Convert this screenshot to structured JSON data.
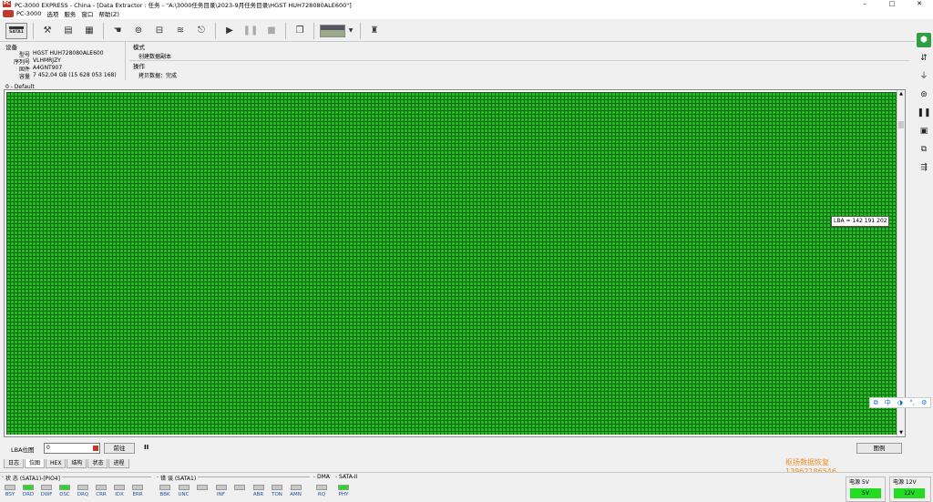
{
  "window": {
    "title": "PC-3000 EXPRESS - China - [Data Extractor : 任务 - \"A:\\3000任务目录\\2023-9月任务目录\\HGST HUH728080ALE600\"]",
    "app_icon_label": "PC",
    "minimize": "–",
    "maximize": "□",
    "close": "✕"
  },
  "menu": {
    "items": [
      "PC-3000",
      "选项",
      "服务",
      "窗口",
      "帮助(Z)"
    ]
  },
  "toolbar": {
    "sata_label": "SATA1"
  },
  "device": {
    "group_title": "设备",
    "rows": [
      {
        "label": "型号",
        "value": "HGST HUH728080ALE600"
      },
      {
        "label": "序列号",
        "value": "VLHMRJZY"
      },
      {
        "label": "固件",
        "value": "A4GNT907"
      },
      {
        "label": "容量",
        "value": "7 452,04 GB (15 628 053 168)"
      }
    ]
  },
  "mode": {
    "mode_title": "模式",
    "mode_value": "创建数据副本",
    "op_title": "操作",
    "op_value": "拷贝数据：完成"
  },
  "map": {
    "label": "0 - Default",
    "lba_tooltip": "LBA =  142 191 202",
    "scroll_up": "▲",
    "scroll_down": "▼",
    "fill_color": "#23b823"
  },
  "ime": {
    "items": [
      "中",
      "◑",
      "°,",
      "⚙"
    ],
    "lang": "中"
  },
  "nav": {
    "label": "LBA位图",
    "input_value": "0",
    "goto_button": "前往",
    "pause_symbol": "II",
    "legend_button": "图例"
  },
  "tabs": [
    "日志",
    "位图",
    "HEX",
    "结构",
    "状态",
    "进程"
  ],
  "watermark": {
    "line1": "枢扬数据恢复",
    "line2": "13962186546"
  },
  "status": {
    "state_title": "状 态 (SATA1)-[PIO4]",
    "state_leds": [
      {
        "name": "BSY",
        "on": false
      },
      {
        "name": "DRD",
        "on": true
      },
      {
        "name": "DWF",
        "on": false
      },
      {
        "name": "DSC",
        "on": true
      },
      {
        "name": "DRQ",
        "on": false
      },
      {
        "name": "CRR",
        "on": false
      },
      {
        "name": "IDX",
        "on": false
      },
      {
        "name": "ERR",
        "on": false
      }
    ],
    "error_title": "错 误 (SATA1)",
    "error_leds": [
      {
        "name": "BBK",
        "on": false
      },
      {
        "name": "UNC",
        "on": false
      },
      {
        "name": "",
        "on": false
      },
      {
        "name": "INF",
        "on": false
      },
      {
        "name": "",
        "on": false
      },
      {
        "name": "ABR",
        "on": false
      },
      {
        "name": "TON",
        "on": false
      },
      {
        "name": "AMN",
        "on": false
      }
    ],
    "dma_title": "DMA",
    "dma_leds": [
      {
        "name": "RQ",
        "on": false
      }
    ],
    "sata_title": "SATA-II",
    "sata_leds": [
      {
        "name": "PHY",
        "on": true
      }
    ],
    "power5_title": "电源 5V",
    "power5_value": "5V",
    "power12_title": "电源 12V",
    "power12_value": "12V",
    "led_on_color": "#22dd22"
  }
}
